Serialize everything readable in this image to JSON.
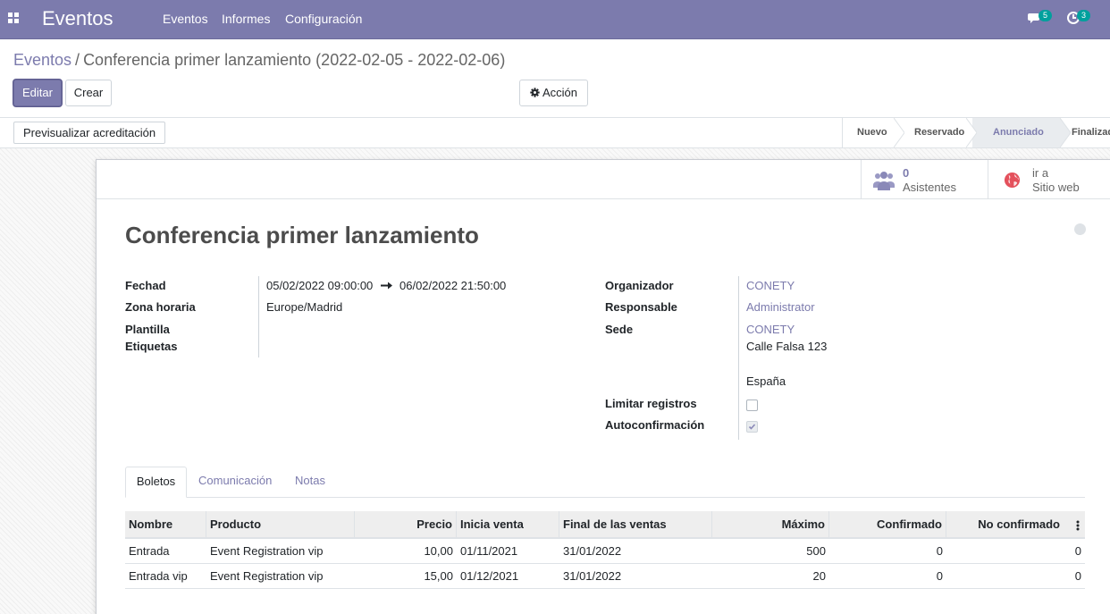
{
  "navbar": {
    "app_name": "Eventos",
    "menu": [
      "Eventos",
      "Informes",
      "Configuración"
    ],
    "messages_count": "5",
    "activities_count": "3"
  },
  "breadcrumb": {
    "parent": "Eventos",
    "separator": "/",
    "current": "Conferencia primer lanzamiento (2022-02-05 - 2022-02-06)"
  },
  "buttons": {
    "edit": "Editar",
    "create": "Crear",
    "action": "Acción",
    "preview_badge": "Previsualizar acreditación"
  },
  "stages": [
    "Nuevo",
    "Reservado",
    "Anunciado",
    "Finalizado"
  ],
  "active_stage": "Anunciado",
  "smart_buttons": {
    "attendees_count": "0",
    "attendees_label": "Asistentes",
    "website_line1": "ir a",
    "website_line2": "Sitio web"
  },
  "event": {
    "title": "Conferencia primer lanzamiento",
    "left_fields": {
      "date_label": "Fechad",
      "date_begin": "05/02/2022 09:00:00",
      "date_end": "06/02/2022 21:50:00",
      "timezone_label": "Zona horaria",
      "timezone": "Europe/Madrid",
      "template_label": "Plantilla",
      "tags_label": "Etiquetas"
    },
    "right_fields": {
      "organizer_label": "Organizador",
      "organizer": "CONETY",
      "responsible_label": "Responsable",
      "responsible": "Administrator",
      "venue_label": "Sede",
      "venue_name": "CONETY",
      "venue_street": "Calle Falsa 123",
      "venue_country": "España",
      "limit_label": "Limitar registros",
      "limit_checked": false,
      "autoconfirm_label": "Autoconfirmación",
      "autoconfirm_checked": true
    }
  },
  "tabs": [
    "Boletos",
    "Comunicación",
    "Notas"
  ],
  "active_tab": "Boletos",
  "tickets": {
    "columns": [
      "Nombre",
      "Producto",
      "Precio",
      "Inicia venta",
      "Final de las ventas",
      "Máximo",
      "Confirmado",
      "No confirmado"
    ],
    "rows": [
      [
        "Entrada",
        "Event Registration vip",
        "10,00",
        "01/11/2021",
        "31/01/2022",
        "500",
        "0",
        "0"
      ],
      [
        "Entrada vip",
        "Event Registration vip",
        "15,00",
        "01/12/2021",
        "31/01/2022",
        "20",
        "0",
        "0"
      ]
    ]
  },
  "colors": {
    "brand": "#7c7bad",
    "badge": "#00a09d",
    "website_icon": "#e4515c"
  },
  "icons": [
    "apps-grid-icon",
    "chat-icon",
    "clock-icon",
    "gear-icon",
    "users-icon",
    "globe-icon",
    "arrow-right-icon",
    "kebab-menu-icon"
  ]
}
